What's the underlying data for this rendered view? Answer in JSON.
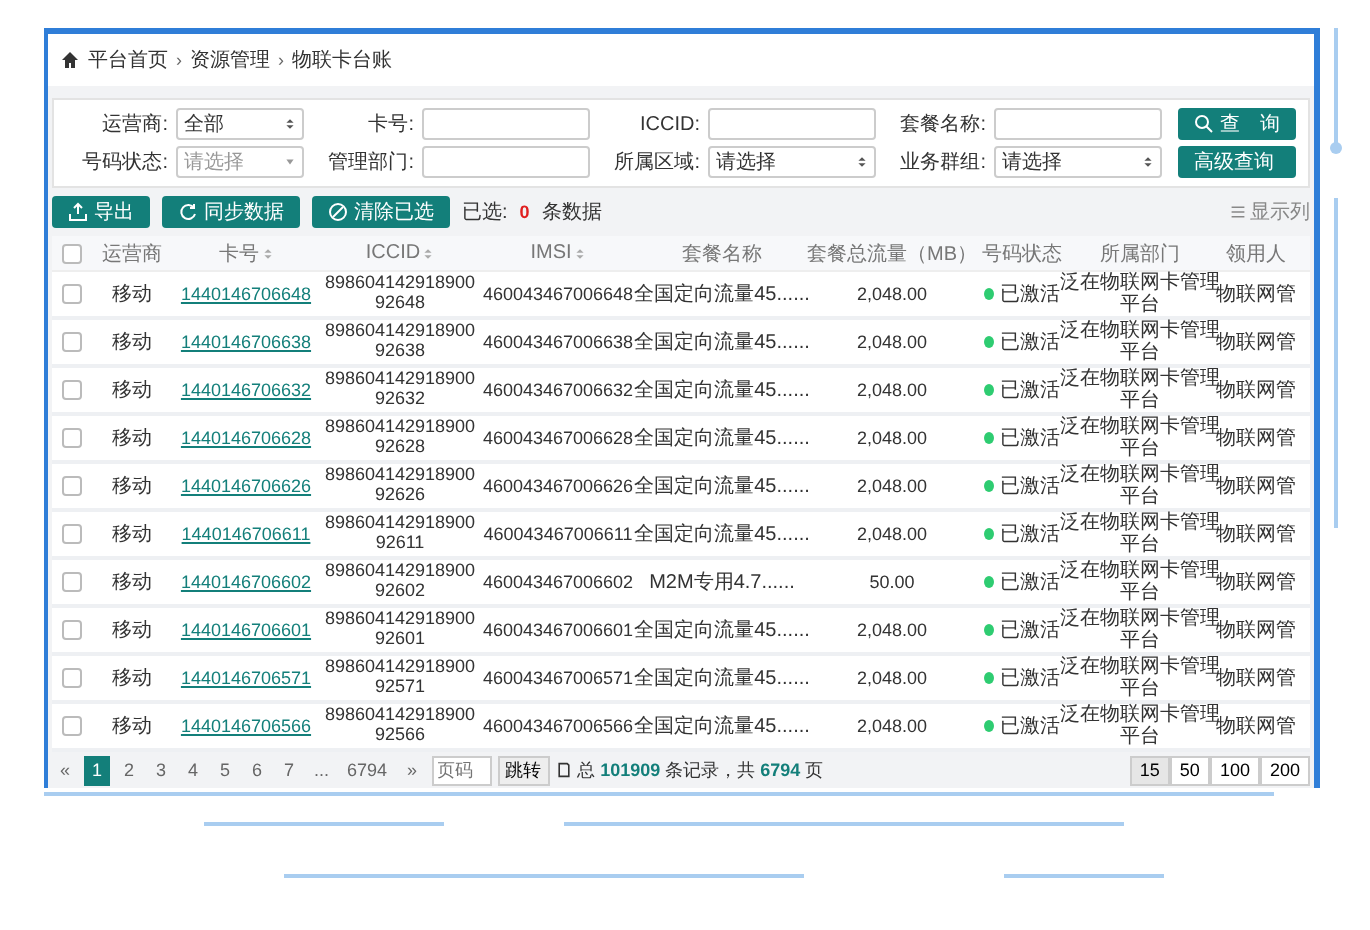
{
  "breadcrumb": [
    "平台首页",
    "资源管理",
    "物联卡台账"
  ],
  "breadcrumb_separator": "›",
  "filters": [
    {
      "kind": "select",
      "label": "运营商:",
      "value": "全部"
    },
    {
      "kind": "input",
      "label": "卡号:"
    },
    {
      "kind": "input",
      "label": "ICCID:"
    },
    {
      "kind": "input",
      "label": "套餐名称:"
    },
    {
      "kind": "dropdown",
      "label": "号码状态:",
      "placeholder": "请选择"
    },
    {
      "kind": "input",
      "label": "管理部门:"
    },
    {
      "kind": "select",
      "label": "所属区域:",
      "value": "请选择"
    },
    {
      "kind": "select",
      "label": "业务群组:",
      "value": "请选择"
    }
  ],
  "search_buttons": [
    "查　询",
    "高级查询"
  ],
  "toolbar": {
    "buttons": [
      {
        "kind": "export",
        "label": "导出"
      },
      {
        "kind": "sync",
        "label": "同步数据"
      },
      {
        "kind": "clear",
        "label": "清除已选"
      }
    ],
    "selected_label": "已选:",
    "selected_count": "0",
    "selected_suffix": "条数据",
    "columns_button": "显示列"
  },
  "table": {
    "select_all_checked": false,
    "columns": [
      {
        "label": "运营商",
        "sortable": false
      },
      {
        "label": "卡号",
        "sortable": true
      },
      {
        "label": "ICCID",
        "sortable": true
      },
      {
        "label": "IMSI",
        "sortable": true
      },
      {
        "label": "套餐名称",
        "sortable": false
      },
      {
        "label": "套餐总流量（MB）",
        "sortable": false
      },
      {
        "label": "号码状态",
        "sortable": false
      },
      {
        "label": "所属部门",
        "sortable": false
      },
      {
        "label": "领用人",
        "sortable": false
      }
    ],
    "rows": [
      {
        "checked": false,
        "cells": [
          "移动",
          "1440146706648",
          "89860414291890092648",
          "460043467006648",
          "全国定向流量45......",
          "2,048.00",
          "已激活",
          "泛在物联网卡管理平台",
          "物联网管"
        ]
      },
      {
        "checked": false,
        "cells": [
          "移动",
          "1440146706638",
          "89860414291890092638",
          "460043467006638",
          "全国定向流量45......",
          "2,048.00",
          "已激活",
          "泛在物联网卡管理平台",
          "物联网管"
        ]
      },
      {
        "checked": false,
        "cells": [
          "移动",
          "1440146706632",
          "89860414291890092632",
          "460043467006632",
          "全国定向流量45......",
          "2,048.00",
          "已激活",
          "泛在物联网卡管理平台",
          "物联网管"
        ]
      },
      {
        "checked": false,
        "cells": [
          "移动",
          "1440146706628",
          "89860414291890092628",
          "460043467006628",
          "全国定向流量45......",
          "2,048.00",
          "已激活",
          "泛在物联网卡管理平台",
          "物联网管"
        ]
      },
      {
        "checked": false,
        "cells": [
          "移动",
          "1440146706626",
          "89860414291890092626",
          "460043467006626",
          "全国定向流量45......",
          "2,048.00",
          "已激活",
          "泛在物联网卡管理平台",
          "物联网管"
        ]
      },
      {
        "checked": false,
        "cells": [
          "移动",
          "1440146706611",
          "89860414291890092611",
          "460043467006611",
          "全国定向流量45......",
          "2,048.00",
          "已激活",
          "泛在物联网卡管理平台",
          "物联网管"
        ]
      },
      {
        "checked": false,
        "cells": [
          "移动",
          "1440146706602",
          "89860414291890092602",
          "460043467006602",
          "M2M专用4.7......",
          "50.00",
          "已激活",
          "泛在物联网卡管理平台",
          "物联网管"
        ]
      },
      {
        "checked": false,
        "cells": [
          "移动",
          "1440146706601",
          "89860414291890092601",
          "460043467006601",
          "全国定向流量45......",
          "2,048.00",
          "已激活",
          "泛在物联网卡管理平台",
          "物联网管"
        ]
      },
      {
        "checked": false,
        "cells": [
          "移动",
          "1440146706571",
          "89860414291890092571",
          "460043467006571",
          "全国定向流量45......",
          "2,048.00",
          "已激活",
          "泛在物联网卡管理平台",
          "物联网管"
        ]
      },
      {
        "checked": false,
        "cells": [
          "移动",
          "1440146706566",
          "89860414291890092566",
          "460043467006566",
          "全国定向流量45......",
          "2,048.00",
          "已激活",
          "泛在物联网卡管理平台",
          "物联网管"
        ]
      }
    ]
  },
  "pagination": {
    "prev": "«",
    "pages": [
      {
        "label": "1",
        "selected": true
      },
      {
        "label": "2",
        "selected": false
      },
      {
        "label": "3",
        "selected": false
      },
      {
        "label": "4",
        "selected": false
      },
      {
        "label": "5",
        "selected": false
      },
      {
        "label": "6",
        "selected": false
      },
      {
        "label": "7",
        "selected": false
      },
      {
        "label": "...",
        "selected": false
      },
      {
        "label": "6794",
        "selected": false
      }
    ],
    "next": "»",
    "page_input_placeholder": "页码",
    "jump": "跳转",
    "summary": "总 **101909** 条记录，共 **6794** 页",
    "sizes": [
      {
        "label": "15",
        "selected": true
      },
      {
        "label": "50",
        "selected": false
      },
      {
        "label": "100",
        "selected": false
      },
      {
        "label": "200",
        "selected": false
      }
    ]
  }
}
